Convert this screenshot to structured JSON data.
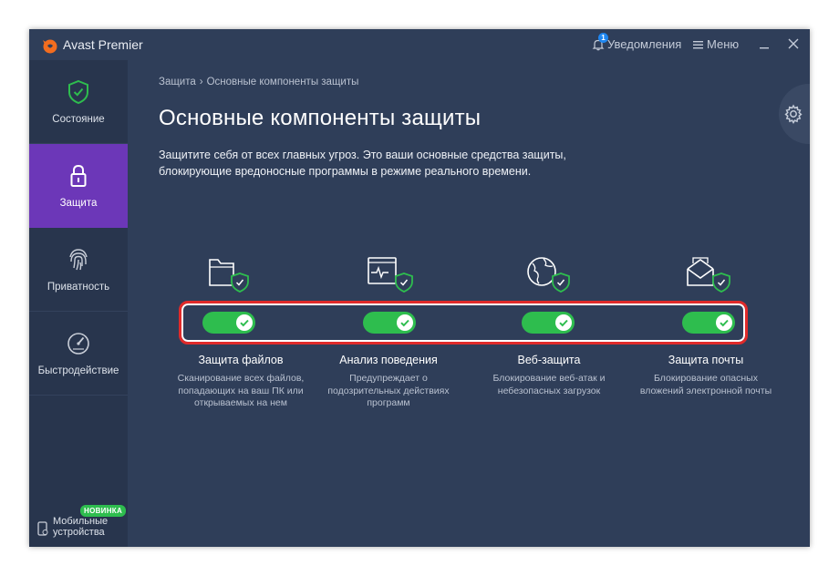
{
  "app": {
    "title": "Avast Premier"
  },
  "titlebar": {
    "notifications_label": "Уведомления",
    "notifications_count": "1",
    "menu_label": "Меню"
  },
  "sidebar": {
    "items": [
      {
        "label": "Состояние",
        "icon": "shield-check-icon",
        "active": false
      },
      {
        "label": "Защита",
        "icon": "lock-icon",
        "active": true
      },
      {
        "label": "Приватность",
        "icon": "fingerprint-icon",
        "active": false
      },
      {
        "label": "Быстродействие",
        "icon": "speedometer-icon",
        "active": false
      }
    ],
    "mobile": {
      "label_line1": "Мобильные",
      "label_line2": "устройства",
      "badge": "НОВИНКА",
      "icon": "mobile-device-icon"
    }
  },
  "main": {
    "breadcrumb": {
      "parent": "Защита",
      "separator": "›",
      "current": "Основные компоненты защиты"
    },
    "title": "Основные компоненты защиты",
    "description_line1": "Защитите себя от всех главных угроз. Это ваши основные средства защиты,",
    "description_line2": "блокирующие вредоносные программы в режиме реального времени.",
    "components": [
      {
        "name": "Защита файлов",
        "desc1": "Сканирование всех файлов,",
        "desc2": "попадающих на ваш ПК или",
        "desc3": "открываемых на нем",
        "enabled": true,
        "icon": "folder-shield-icon"
      },
      {
        "name": "Анализ поведения",
        "desc1": "Предупреждает о",
        "desc2": "подозрительных действиях",
        "desc3": "программ",
        "enabled": true,
        "icon": "monitor-pulse-shield-icon"
      },
      {
        "name": "Веб-защита",
        "desc1": "Блокирование веб-атак и",
        "desc2": "небезопасных загрузок",
        "desc3": "",
        "enabled": true,
        "icon": "globe-shield-icon"
      },
      {
        "name": "Защита почты",
        "desc1": "Блокирование опасных",
        "desc2": "вложений электронной почты",
        "desc3": "",
        "enabled": true,
        "icon": "envelope-shield-icon"
      }
    ]
  },
  "colors": {
    "background": "#2f3e59",
    "sidebar": "#28354d",
    "active_nav": "#6c37b8",
    "toggle_on": "#2ebd4e",
    "highlight_border": "#e02a2a",
    "brand_orange": "#f36d1f"
  }
}
